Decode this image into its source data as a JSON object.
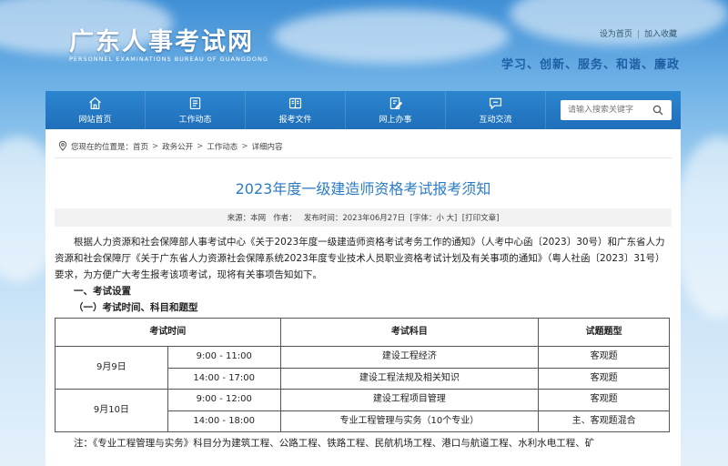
{
  "header": {
    "logo_cn": "广东人事考试网",
    "logo_en": "PERSONNEL EXAMINATIONS BUREAU OF GUANGDONG",
    "links": [
      "设为首页",
      "加入收藏"
    ],
    "link_separator": "|",
    "slogan": "学习、创新、服务、和谐、廉政"
  },
  "nav": {
    "items": [
      {
        "label": "网站首页",
        "icon": "home-icon"
      },
      {
        "label": "工作动态",
        "icon": "document-list-icon"
      },
      {
        "label": "报考文件",
        "icon": "book-icon"
      },
      {
        "label": "网上办事",
        "icon": "edit-document-icon"
      },
      {
        "label": "互动交流",
        "icon": "chat-icon"
      }
    ],
    "search_placeholder": "请输入搜索关键字",
    "search_icon": "search-icon"
  },
  "breadcrumb": {
    "prefix": "您现在的位置是：",
    "items": [
      "首页",
      "政务公开",
      "工作动态",
      "详细内容"
    ],
    "separator": ">"
  },
  "article": {
    "title": "2023年度一级建造师资格考试报考须知",
    "meta": {
      "source": "来源：本网",
      "author": "作者：",
      "date": "发布时间：2023年06月27日",
      "font_size": "[字体：小 大]",
      "print": "[打印文章]"
    },
    "intro": "根据人力资源和社会保障部人事考试中心《关于2023年度一级建造师资格考试考务工作的通知》（人考中心函〔2023〕30号）和广东省人力资源和社会保障厅《关于广东省人力资源社会保障系统2023年度专业技术人员职业资格考试计划及有关事项的通知》（粤人社函〔2023〕31号）要求，为方便广大考生报考该项考试，现将有关事项告知如下。",
    "section1": "一、考试设置",
    "section1_1": "（一）考试时间、科目和题型",
    "table": {
      "headers": [
        "考试时间",
        "考试科目",
        "试题题型"
      ],
      "days": [
        {
          "date": "9月9日",
          "rows": [
            {
              "time": "9:00 - 11:00",
              "subject": "建设工程经济",
              "type": "客观题"
            },
            {
              "time": "14:00 - 17:00",
              "subject": "建设工程法规及相关知识",
              "type": "客观题"
            }
          ]
        },
        {
          "date": "9月10日",
          "rows": [
            {
              "time": "9:00 - 12:00",
              "subject": "建设工程项目管理",
              "type": "客观题"
            },
            {
              "time": "14:00 - 18:00",
              "subject": "专业工程管理与实务（10个专业）",
              "type": "主、客观题混合"
            }
          ]
        }
      ]
    },
    "note": "注：《专业工程管理与实务》科目分为建筑工程、公路工程、铁路工程、民航机场工程、港口与航道工程、水利水电工程、矿"
  }
}
